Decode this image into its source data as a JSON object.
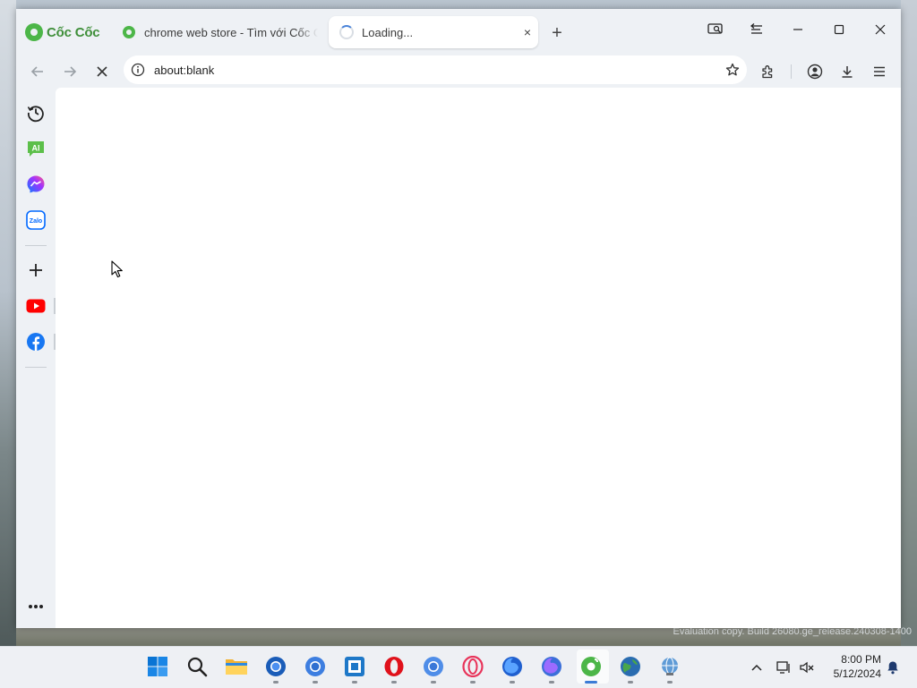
{
  "browser": {
    "brand": "Cốc Cốc",
    "accent_color": "#4cb648"
  },
  "tabs": [
    {
      "label": "chrome web store - Tìm với Cốc C",
      "favicon": "coccoc-icon",
      "active": false
    },
    {
      "label": "Loading...",
      "favicon": "loading-spinner",
      "active": true,
      "close": "×"
    }
  ],
  "new_tab_label": "+",
  "window_controls": [
    "screenshot-icon",
    "sidebar-toggle-icon",
    "minimize-icon",
    "maximize-icon",
    "close-icon"
  ],
  "toolbar": {
    "back": "back-arrow-icon",
    "forward": "forward-arrow-icon",
    "stop": "stop-icon",
    "url": "about:blank",
    "right_icons": [
      "extensions-icon",
      "profile-icon",
      "download-icon",
      "menu-icon"
    ]
  },
  "sidebar": {
    "items": [
      "history-icon",
      "ai-chat-icon",
      "messenger-icon",
      "zalo-icon",
      "add-icon",
      "youtube-icon",
      "facebook-icon",
      "more-icon"
    ],
    "ai_label": "AI",
    "zalo_label": "Zalo"
  },
  "taskbar": {
    "apps": [
      "windows-start-icon",
      "search-icon",
      "file-explorer-icon",
      "chromium-icon",
      "chrome-icon",
      "mail-app-icon",
      "opera-icon",
      "chrome-beta-icon",
      "opera-gx-icon",
      "firefox-icon",
      "firefox-dev-icon",
      "coccoc-icon",
      "earth-browser-icon",
      "network-globe-icon"
    ],
    "time": "8:00 PM",
    "date": "5/12/2024"
  },
  "watermark": "Evaluation copy. Build 26080.ge_release.240308-1400"
}
